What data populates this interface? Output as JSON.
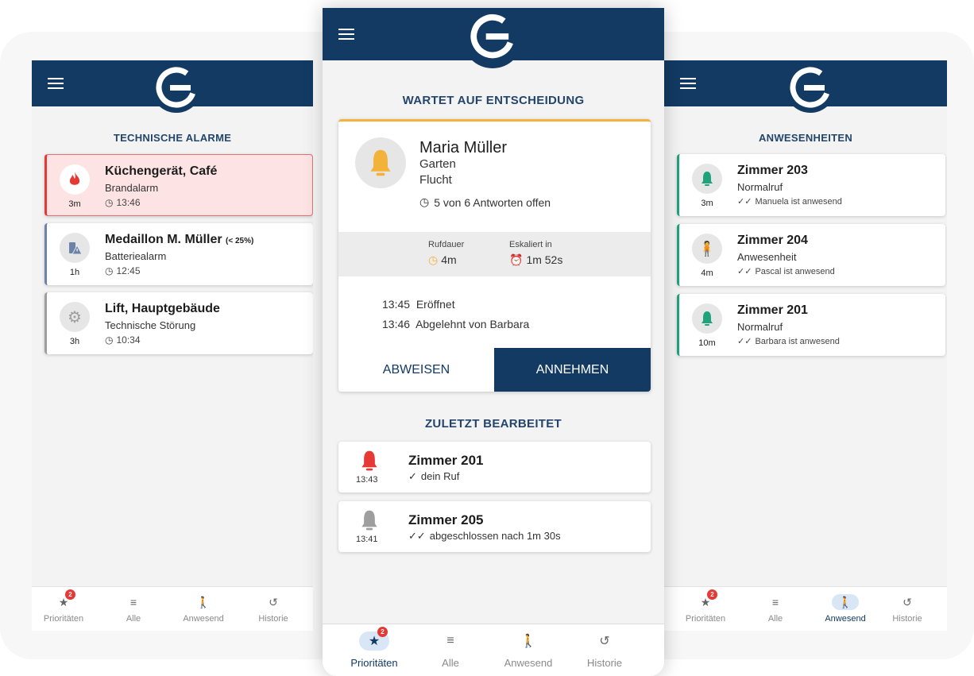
{
  "left": {
    "section_title": "TECHNISCHE ALARME",
    "cards": [
      {
        "title": "Küchengerät, Café",
        "title_note": "",
        "sub": "Brandalarm",
        "time": "13:46",
        "age": "3m",
        "icon": "fire-icon"
      },
      {
        "title": "Medaillon M. Müller",
        "title_note": "(< 25%)",
        "sub": "Batteriealarm",
        "time": "12:45",
        "age": "1h",
        "icon": "battery-warning-icon"
      },
      {
        "title": "Lift, Hauptgebäude",
        "title_note": "",
        "sub": "Technische Störung",
        "time": "10:34",
        "age": "3h",
        "icon": "gear-icon"
      }
    ],
    "nav": {
      "prio": "Prioritäten",
      "alle": "Alle",
      "anwesend": "Anwesend",
      "historie": "Historie",
      "badge": "2"
    }
  },
  "center": {
    "section_title": "WARTET AUF ENTSCHEIDUNG",
    "person": "Maria Müller",
    "location": "Garten",
    "reason": "Flucht",
    "responses": "5 von 6 Antworten offen",
    "rufdauer_label": "Rufdauer",
    "rufdauer_value": "4m",
    "eskaliert_label": "Eskaliert in",
    "eskaliert_value": "1m 52s",
    "log": [
      {
        "time": "13:45",
        "text": "Eröffnet"
      },
      {
        "time": "13:46",
        "text": "Abgelehnt von Barbara"
      }
    ],
    "reject_label": "ABWEISEN",
    "accept_label": "ANNEHMEN",
    "recent_title": "ZULETZT BEARBEITET",
    "recent": [
      {
        "title": "Zimmer 201",
        "sub": "dein Ruf",
        "time": "13:43"
      },
      {
        "title": "Zimmer 205",
        "sub": "abgeschlossen nach 1m 30s",
        "time": "13:41"
      }
    ],
    "nav": {
      "prio": "Prioritäten",
      "alle": "Alle",
      "anwesend": "Anwesend",
      "historie": "Historie",
      "badge": "2"
    }
  },
  "right": {
    "section_title": "ANWESENHEITEN",
    "cards": [
      {
        "title": "Zimmer 203",
        "sub": "Normalruf",
        "meta": "Manuela ist anwesend",
        "age": "3m",
        "icon": "bell-icon"
      },
      {
        "title": "Zimmer 204",
        "sub": "Anwesenheit",
        "meta": "Pascal ist anwesend",
        "age": "4m",
        "icon": "person-icon"
      },
      {
        "title": "Zimmer 201",
        "sub": "Normalruf",
        "meta": "Barbara ist anwesend",
        "age": "10m",
        "icon": "bell-icon"
      }
    ],
    "nav": {
      "prio": "Prioritäten",
      "alle": "Alle",
      "anwesend": "Anwesend",
      "historie": "Historie",
      "badge": "2"
    }
  },
  "colors": {
    "brand": "#123a63",
    "fire": "#e53935",
    "battery": "#6b83a8",
    "gear": "#9e9e9e",
    "presence": "#1fa37a",
    "warning": "#f3b23a"
  }
}
